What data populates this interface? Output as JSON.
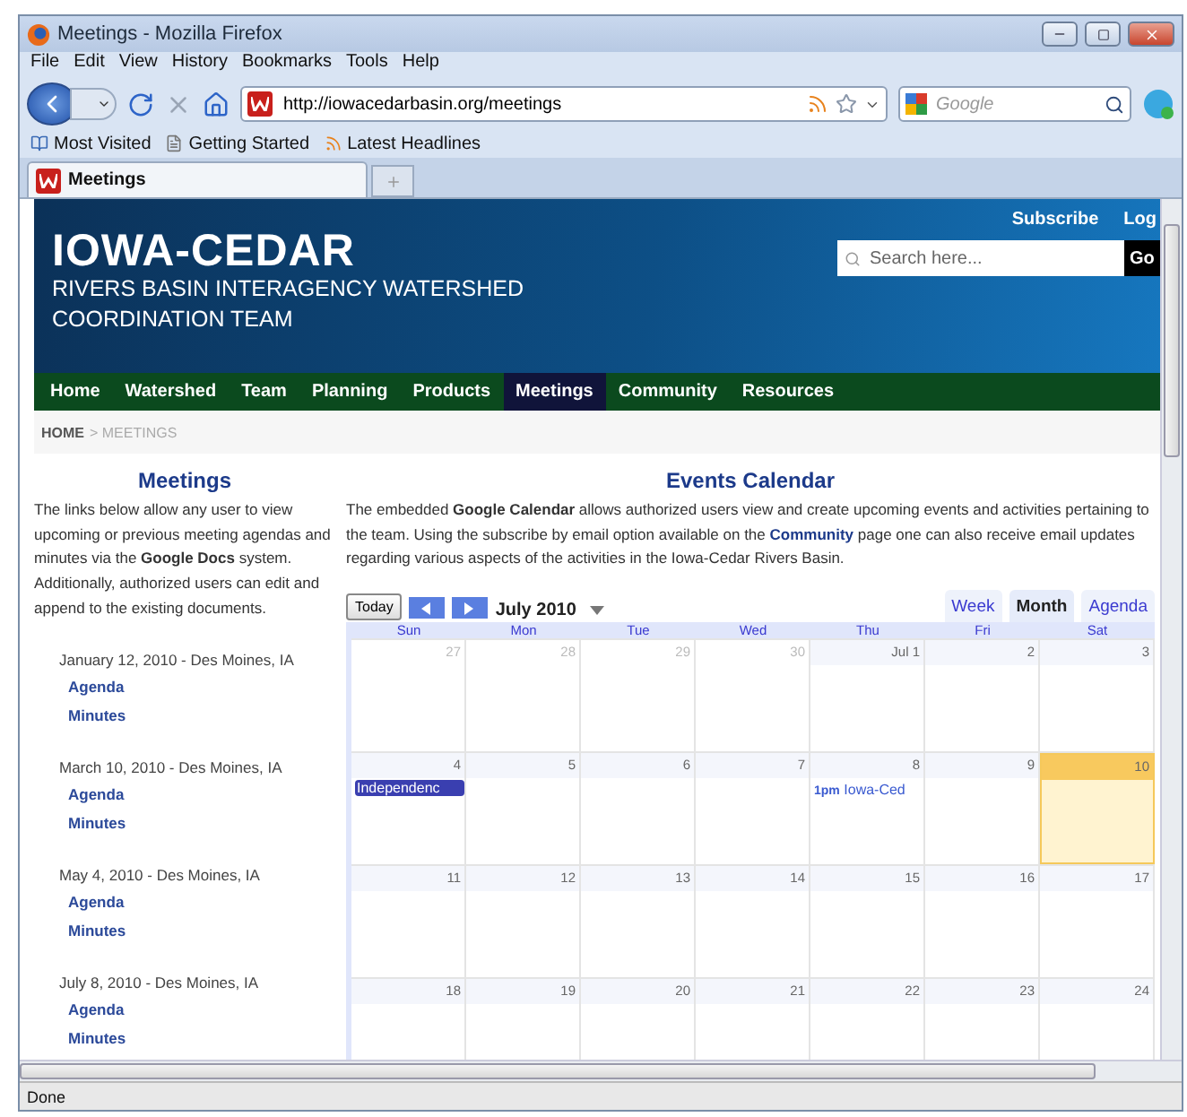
{
  "window": {
    "title": "Meetings - Mozilla Firefox"
  },
  "menu": [
    "File",
    "Edit",
    "View",
    "History",
    "Bookmarks",
    "Tools",
    "Help"
  ],
  "address": {
    "value": "http://iowacedarbasin.org/meetings"
  },
  "web_search": {
    "placeholder": "Google"
  },
  "bookmarks": [
    "Most Visited",
    "Getting Started",
    "Latest Headlines"
  ],
  "tabs": [
    {
      "label": "Meetings",
      "selected": true
    }
  ],
  "site": {
    "top_links": [
      "Subscribe",
      "Log"
    ],
    "title": "IOWA-CEDAR",
    "subtitle_lines": [
      "RIVERS BASIN INTERAGENCY WATERSHED",
      "COORDINATION TEAM"
    ],
    "search": {
      "placeholder": "Search here...",
      "button": "Go"
    }
  },
  "nav": [
    {
      "label": "Home",
      "selected": false
    },
    {
      "label": "Watershed",
      "selected": false
    },
    {
      "label": "Team",
      "selected": false
    },
    {
      "label": "Planning",
      "selected": false
    },
    {
      "label": "Products",
      "selected": false
    },
    {
      "label": "Meetings",
      "selected": true
    },
    {
      "label": "Community",
      "selected": false
    },
    {
      "label": "Resources",
      "selected": false
    }
  ],
  "breadcrumb": {
    "home": "HOME",
    "current": "> MEETINGS"
  },
  "meetings": {
    "heading": "Meetings",
    "intro": "The links below allow any user to view upcoming or previous meeting agendas and minutes via the **Google Docs** system. Additionally, authorized users can edit and append to the existing documents.",
    "items": [
      {
        "date": "January 12, 2010 - Des Moines, IA",
        "links": [
          "Agenda",
          "Minutes"
        ]
      },
      {
        "date": "March 10, 2010 - Des Moines, IA",
        "links": [
          "Agenda",
          "Minutes"
        ]
      },
      {
        "date": "May 4, 2010 - Des Moines, IA",
        "links": [
          "Agenda",
          "Minutes"
        ]
      },
      {
        "date": "July 8, 2010 - Des Moines, IA",
        "links": [
          "Agenda",
          "Minutes"
        ]
      }
    ]
  },
  "calendar": {
    "heading": "Events Calendar",
    "intro": [
      {
        "kind": "text",
        "text": "The embedded **Google Calendar** allows authorized users view and create upcoming events and activities pertaining to the team. Using the subscribe by email option available on the"
      },
      {
        "kind": "link",
        "text": "Community"
      },
      {
        "kind": "text",
        "text": "page one can also receive email updates regarding various aspects of the activities in the Iowa-Cedar Rivers Basin."
      }
    ],
    "today_button": "Today",
    "month": "July 2010",
    "views": [
      {
        "label": "Week",
        "selected": false
      },
      {
        "label": "Month",
        "selected": true
      },
      {
        "label": "Agenda",
        "selected": false
      }
    ],
    "weekdays": [
      "Sun",
      "Mon",
      "Tue",
      "Wed",
      "Thu",
      "Fri",
      "Sat"
    ],
    "weeks": [
      [
        {
          "day": "27",
          "other_month": true
        },
        {
          "day": "28",
          "other_month": true
        },
        {
          "day": "29",
          "other_month": true
        },
        {
          "day": "30",
          "other_month": true
        },
        {
          "day": "Jul 1",
          "other_month": false
        },
        {
          "day": "2",
          "other_month": false
        },
        {
          "day": "3",
          "other_month": false
        }
      ],
      [
        {
          "day": "4",
          "other_month": false,
          "events": [
            {
              "kind": "allday",
              "title": "Independenc"
            }
          ]
        },
        {
          "day": "5",
          "other_month": false
        },
        {
          "day": "6",
          "other_month": false
        },
        {
          "day": "7",
          "other_month": false
        },
        {
          "day": "8",
          "other_month": false,
          "events": [
            {
              "kind": "timed",
              "time": "1pm",
              "title": "Iowa-Ced"
            }
          ]
        },
        {
          "day": "9",
          "other_month": false
        },
        {
          "day": "10",
          "other_month": false,
          "today": true
        }
      ],
      [
        {
          "day": "11",
          "other_month": false
        },
        {
          "day": "12",
          "other_month": false
        },
        {
          "day": "13",
          "other_month": false
        },
        {
          "day": "14",
          "other_month": false
        },
        {
          "day": "15",
          "other_month": false
        },
        {
          "day": "16",
          "other_month": false
        },
        {
          "day": "17",
          "other_month": false
        }
      ],
      [
        {
          "day": "18",
          "other_month": false
        },
        {
          "day": "19",
          "other_month": false
        },
        {
          "day": "20",
          "other_month": false
        },
        {
          "day": "21",
          "other_month": false
        },
        {
          "day": "22",
          "other_month": false
        },
        {
          "day": "23",
          "other_month": false
        },
        {
          "day": "24",
          "other_month": false
        }
      ]
    ]
  },
  "status_bar": "Done"
}
